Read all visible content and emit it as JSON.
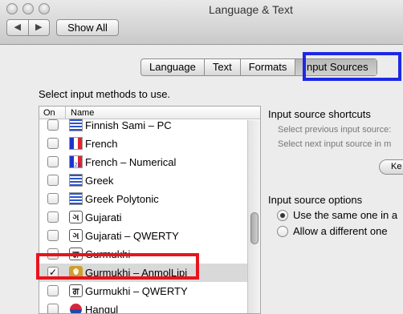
{
  "window": {
    "title": "Language & Text"
  },
  "toolbar": {
    "back_label": "◀",
    "forward_label": "▶",
    "show_all_label": "Show All"
  },
  "tabs": [
    {
      "label": "Language"
    },
    {
      "label": "Text"
    },
    {
      "label": "Formats"
    },
    {
      "label": "Input Sources",
      "selected": true
    }
  ],
  "input_methods": {
    "heading": "Select input methods to use.",
    "columns": {
      "on": "On",
      "name": "Name"
    },
    "rows": [
      {
        "name": "Finnish Sami – PC",
        "checked": false,
        "icon": "finnish-flag-icon"
      },
      {
        "name": "French",
        "checked": false,
        "icon": "french-flag-icon"
      },
      {
        "name": "French – Numerical",
        "checked": false,
        "icon": "french-numerical-flag-icon",
        "icon_text": "123"
      },
      {
        "name": "Greek",
        "checked": false,
        "icon": "greek-flag-icon"
      },
      {
        "name": "Greek Polytonic",
        "checked": false,
        "icon": "greek-polytonic-flag-icon"
      },
      {
        "name": "Gujarati",
        "checked": false,
        "icon": "gujarati-script-icon",
        "icon_text": "ગ"
      },
      {
        "name": "Gujarati – QWERTY",
        "checked": false,
        "icon": "gujarati-script-icon",
        "icon_text": "ગ"
      },
      {
        "name": "Gurmukhi",
        "checked": false,
        "icon": "gurmukhi-script-icon",
        "icon_text": "ਗ"
      },
      {
        "name": "Gurmukhi – AnmolLipi",
        "checked": true,
        "icon": "khanda-icon",
        "icon_text": "☬"
      },
      {
        "name": "Gurmukhi – QWERTY",
        "checked": false,
        "icon": "gurmukhi-script-icon",
        "icon_text": "ਗ"
      },
      {
        "name": "Hangul",
        "checked": false,
        "icon": "korean-hangul-icon"
      }
    ]
  },
  "shortcuts": {
    "heading": "Input source shortcuts",
    "prev_label": "Select previous input source:",
    "next_label": "Select next input source in m",
    "keyboard_button": "Ke"
  },
  "options": {
    "heading": "Input source options",
    "same_label": "Use the same one in a",
    "different_label": "Allow a different one",
    "selected": "same"
  },
  "colors": {
    "highlight_blue": "#1d28e6",
    "highlight_red": "#e8141c"
  }
}
